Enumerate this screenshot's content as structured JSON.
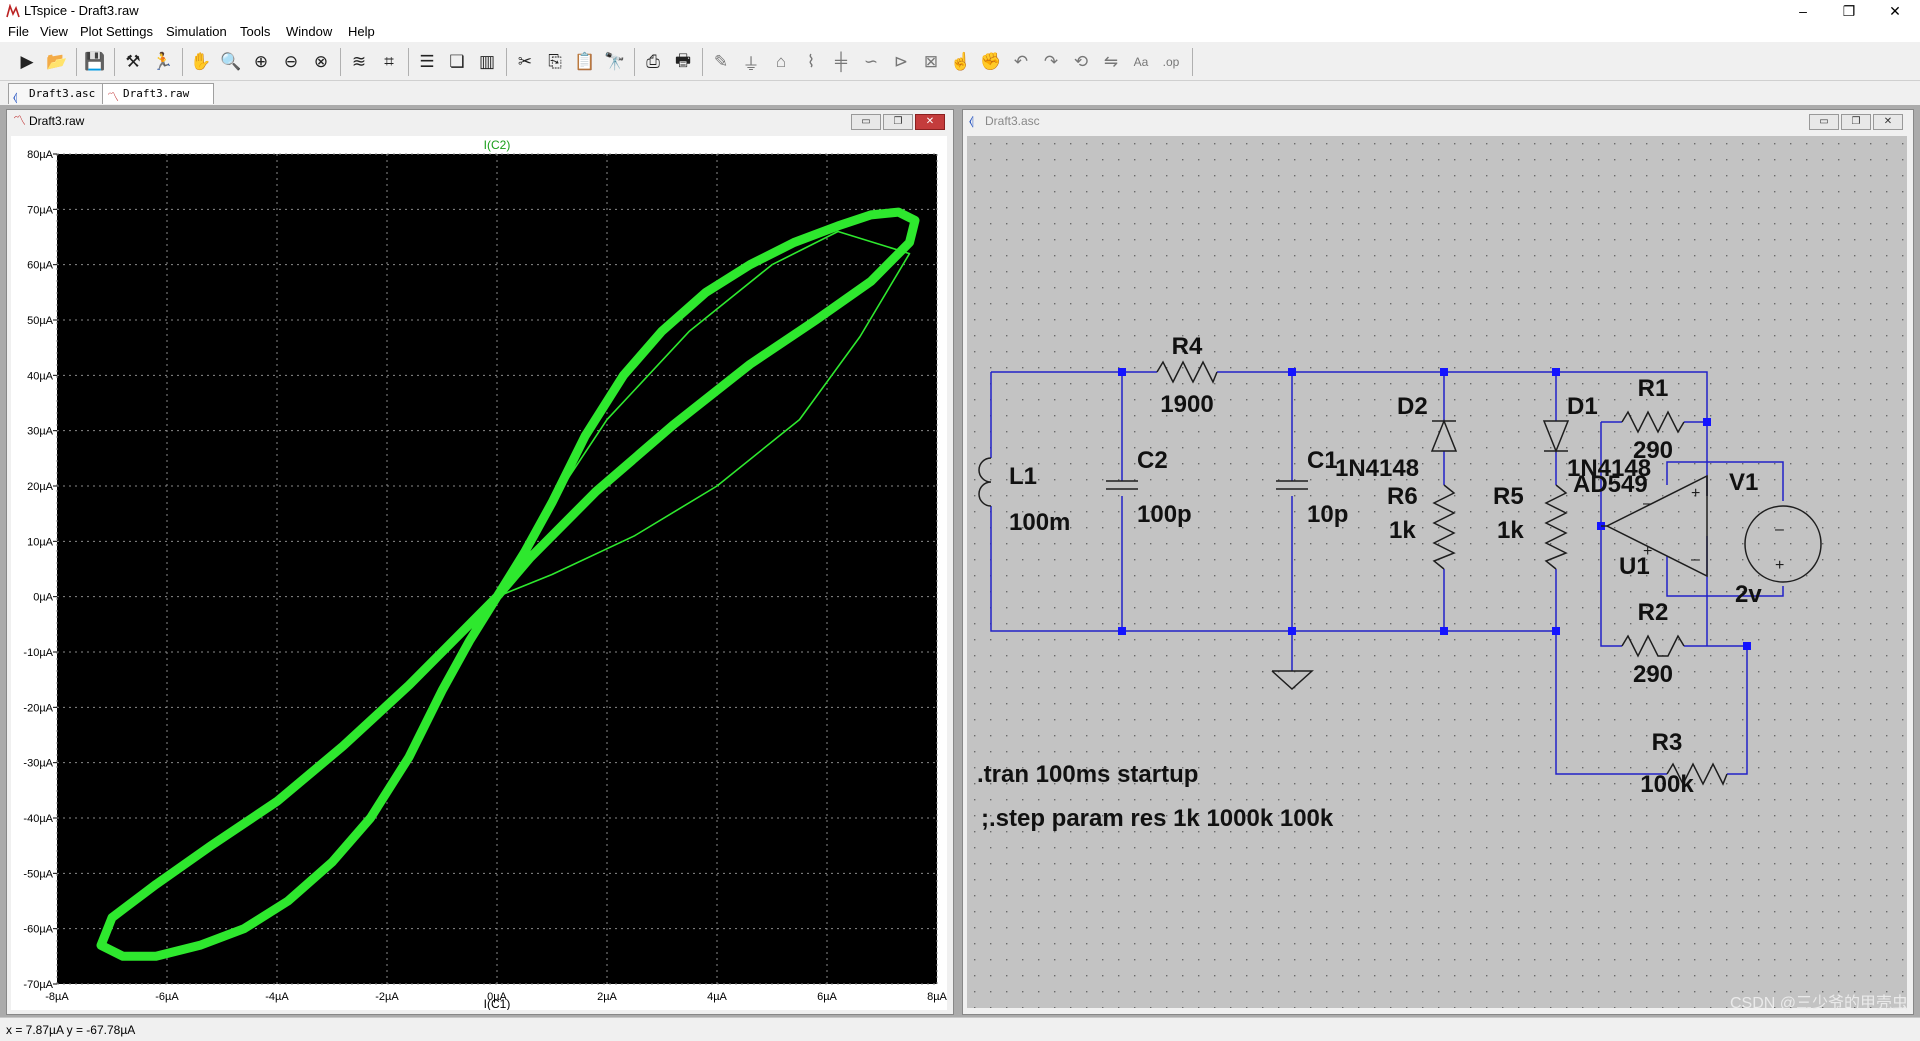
{
  "app": {
    "title": "LTspice - Draft3.raw",
    "window_controls": {
      "minimize": "–",
      "restore": "❐",
      "close": "✕"
    }
  },
  "menu": [
    {
      "label": "File"
    },
    {
      "label": "View"
    },
    {
      "label": "Plot Settings"
    },
    {
      "label": "Simulation"
    },
    {
      "label": "Tools"
    },
    {
      "label": "Window"
    },
    {
      "label": "Help"
    }
  ],
  "toolbar": {
    "icons": [
      "run-icon",
      "open-icon",
      "save-icon",
      "control-panel-icon",
      "run-sim-icon",
      "pan-icon",
      "zoom-in-icon",
      "zoom-box-icon",
      "zoom-out-icon",
      "zoom-fit-icon",
      "autorange-icon",
      "markers-icon",
      "tile-horizontal-icon",
      "cascade-icon",
      "tile-vertical-icon",
      "cut-icon",
      "copy-icon",
      "paste-icon",
      "find-icon",
      "print-icon",
      "print-preview-icon",
      "wire-icon",
      "ground-icon",
      "label-icon",
      "resistor-icon",
      "capacitor-icon",
      "inductor-icon",
      "diode-icon",
      "component-icon",
      "move-icon",
      "drag-icon",
      "undo-icon",
      "redo-icon",
      "rotate-icon",
      "mirror-icon",
      "text-icon",
      "spice-directive-icon"
    ]
  },
  "tabs": [
    {
      "label": "Draft3.asc"
    },
    {
      "label": "Draft3.raw"
    }
  ],
  "plot_window": {
    "title": "Draft3.raw"
  },
  "schematic_window": {
    "title": "Draft3.asc",
    "components": {
      "r4": {
        "ref": "R4",
        "value": "1900"
      },
      "l1": {
        "ref": "L1",
        "value": "100m"
      },
      "c2": {
        "ref": "C2",
        "value": "100p"
      },
      "c1": {
        "ref": "C1",
        "value": "10p"
      },
      "d2": {
        "ref": "D2",
        "model": "1N4148"
      },
      "d1": {
        "ref": "D1",
        "model": "1N4148"
      },
      "r6": {
        "ref": "R6",
        "value": "1k"
      },
      "r5": {
        "ref": "R5",
        "value": "1k"
      },
      "r1": {
        "ref": "R1",
        "value": "290"
      },
      "r2": {
        "ref": "R2",
        "value": "290"
      },
      "r3": {
        "ref": "R3",
        "value": "100k"
      },
      "u1": {
        "ref": "U1",
        "model": "AD549"
      },
      "v1": {
        "ref": "V1",
        "value": "2v"
      }
    },
    "directives": [
      ".tran 100ms startup",
      ";.step param res 1k 1000k 100k"
    ]
  },
  "chart_data": {
    "type": "line",
    "title": "I(C2)",
    "xlabel": "I(C1)",
    "ylabel": "",
    "xlim": [
      -8,
      8
    ],
    "ylim": [
      -70,
      80
    ],
    "x_unit": "µA",
    "y_unit": "µA",
    "grid": true,
    "background": "#000000",
    "trace_color": "#2ee82e",
    "x_ticks": [
      "-8µA",
      "-6µA",
      "-4µA",
      "-2µA",
      "0µA",
      "2µA",
      "4µA",
      "6µA",
      "8µA"
    ],
    "y_ticks": [
      "80µA",
      "70µA",
      "60µA",
      "50µA",
      "40µA",
      "30µA",
      "20µA",
      "10µA",
      "0µA",
      "-10µA",
      "-20µA",
      "-30µA",
      "-40µA",
      "-50µA",
      "-60µA",
      "-70µA"
    ],
    "series": [
      {
        "points": [
          [
            0,
            0
          ],
          [
            0.5,
            8
          ],
          [
            1,
            17
          ],
          [
            1.6,
            29
          ],
          [
            2.3,
            40
          ],
          [
            3,
            48
          ],
          [
            3.8,
            55
          ],
          [
            4.6,
            60
          ],
          [
            5.4,
            64
          ],
          [
            6.2,
            67
          ],
          [
            6.8,
            69
          ],
          [
            7.3,
            69.5
          ],
          [
            7.6,
            68
          ],
          [
            7.5,
            64
          ],
          [
            6.8,
            57
          ],
          [
            5.8,
            50
          ],
          [
            4.6,
            42
          ],
          [
            3.2,
            31
          ],
          [
            1.8,
            19
          ],
          [
            0.6,
            7
          ],
          [
            0,
            0
          ],
          [
            -0.5,
            -8
          ],
          [
            -1,
            -17
          ],
          [
            -1.6,
            -29
          ],
          [
            -2.3,
            -40
          ],
          [
            -3,
            -48
          ],
          [
            -3.8,
            -55
          ],
          [
            -4.6,
            -60
          ],
          [
            -5.4,
            -63
          ],
          [
            -6.2,
            -65
          ],
          [
            -6.8,
            -65
          ],
          [
            -7.2,
            -63
          ],
          [
            -7.0,
            -58
          ],
          [
            -6.2,
            -52
          ],
          [
            -5.2,
            -45
          ],
          [
            -4,
            -37
          ],
          [
            -2.8,
            -27
          ],
          [
            -1.6,
            -16
          ],
          [
            -0.6,
            -6
          ],
          [
            0,
            0
          ]
        ]
      },
      {
        "points": [
          [
            0,
            0
          ],
          [
            1,
            4
          ],
          [
            2.5,
            11
          ],
          [
            4,
            20
          ],
          [
            5.5,
            32
          ],
          [
            6.6,
            47
          ],
          [
            7.5,
            62
          ],
          [
            6.2,
            66
          ],
          [
            5,
            60
          ],
          [
            3.5,
            48
          ],
          [
            2,
            32
          ],
          [
            1,
            17
          ],
          [
            0.2,
            4
          ]
        ]
      }
    ]
  },
  "status": {
    "cursor": "x = 7.87µA    y = -67.78µA"
  },
  "watermark": "CSDN @三少爷的甲壳虫"
}
